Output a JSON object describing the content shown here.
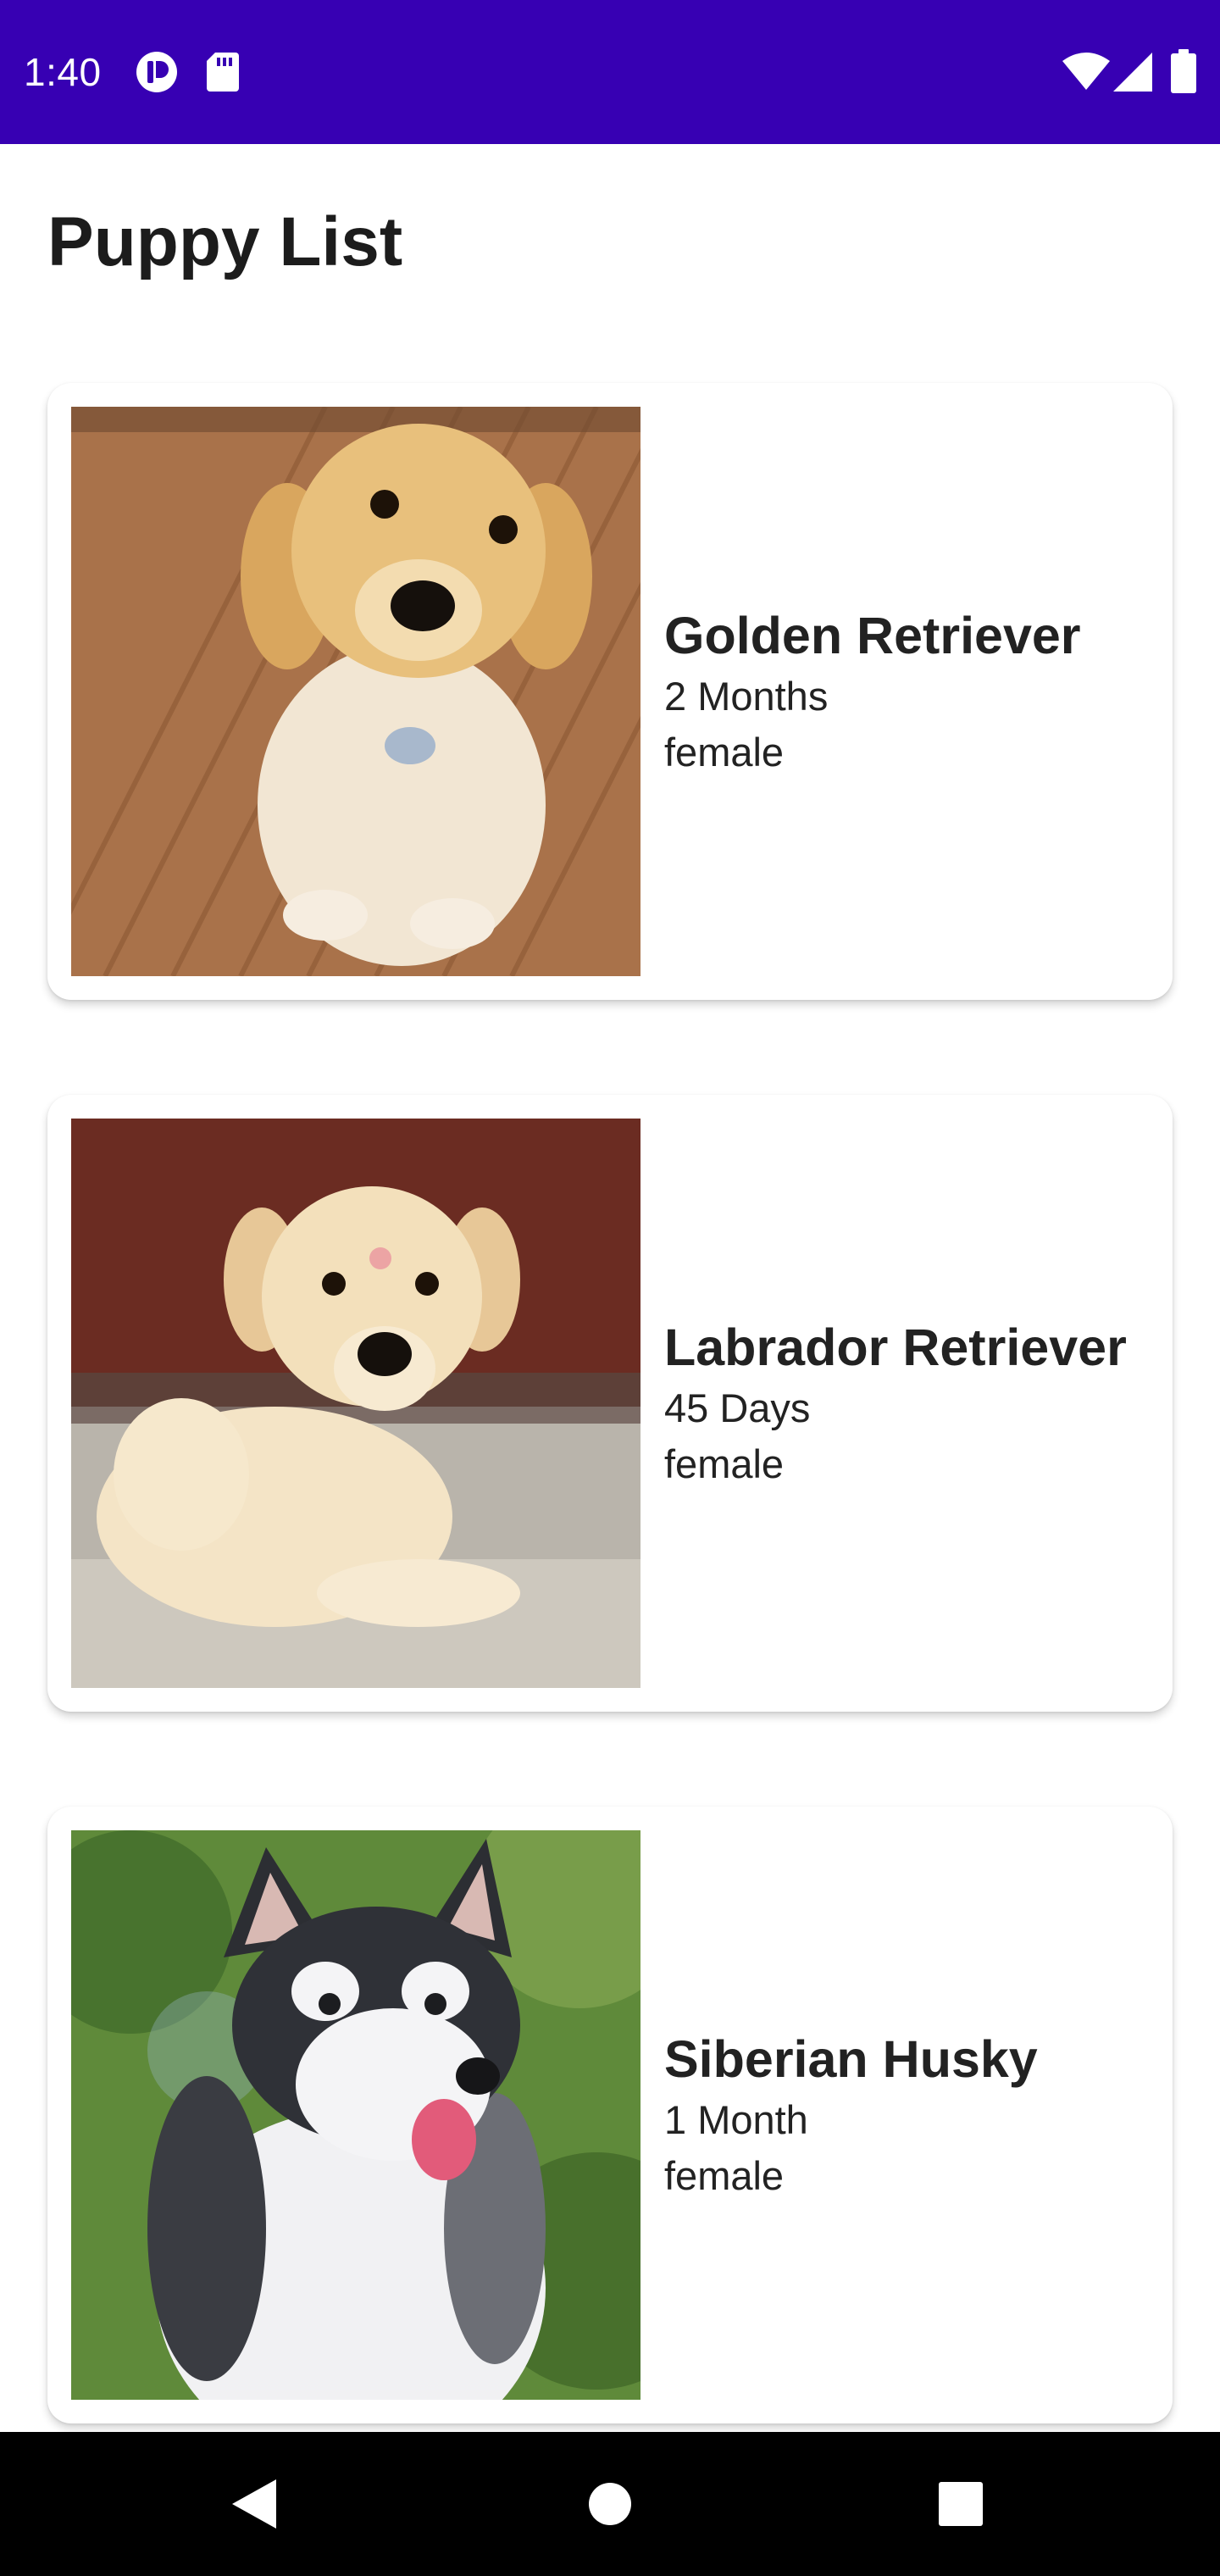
{
  "status_bar": {
    "time": "1:40",
    "background": "#3700b3",
    "left_icons": [
      "notification-app-icon",
      "sd-card-icon"
    ],
    "right_icons": [
      "wifi-icon",
      "cell-signal-icon",
      "battery-icon"
    ]
  },
  "page": {
    "title": "Puppy List"
  },
  "puppies": [
    {
      "breed": "Golden Retriever",
      "age": "2 Months",
      "gender": "female",
      "photo": "golden-retriever-puppy-photo"
    },
    {
      "breed": "Labrador Retriever",
      "age": "45 Days",
      "gender": "female",
      "photo": "labrador-retriever-puppy-photo"
    },
    {
      "breed": "Siberian Husky",
      "age": "1 Month",
      "gender": "female",
      "photo": "siberian-husky-puppy-photo"
    }
  ],
  "nav_bar": {
    "buttons": [
      "back-icon",
      "home-icon",
      "recents-icon"
    ]
  }
}
